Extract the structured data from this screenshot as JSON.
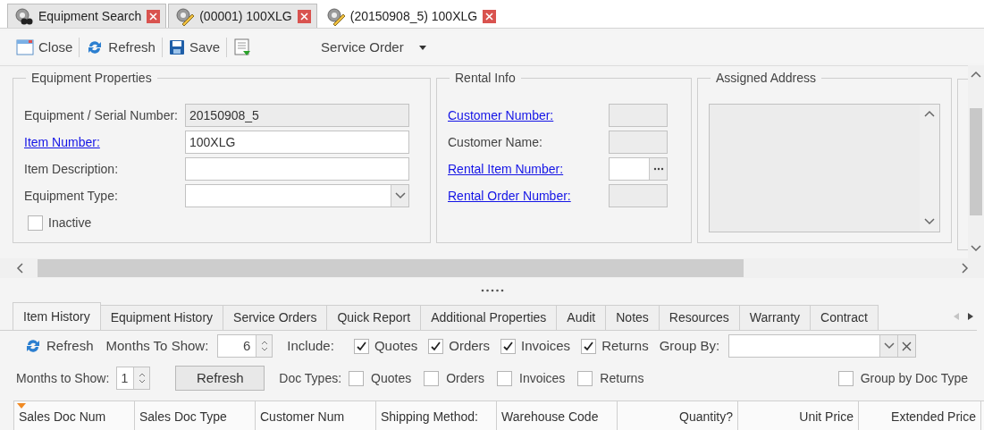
{
  "doc_tabs": [
    {
      "label": "Equipment Search",
      "kind": "search",
      "selected": false
    },
    {
      "label": "(00001) 100XLG",
      "kind": "edit",
      "selected": false
    },
    {
      "label": "(20150908_5) 100XLG",
      "kind": "edit",
      "selected": true
    }
  ],
  "toolbar": [
    {
      "label": "Close",
      "kind": "close"
    },
    {
      "label": "Refresh",
      "kind": "refresh"
    },
    {
      "label": "Save",
      "kind": "save"
    },
    {
      "kind": "report"
    },
    {
      "label": "Service Order",
      "kind": "dropdown"
    }
  ],
  "equipment_properties": {
    "title": "Equipment Properties",
    "fields": [
      {
        "label": "Equipment / Serial Number:",
        "link": false,
        "kind": "text",
        "readonly": true,
        "value": "20150908_5"
      },
      {
        "label": "Item Number:",
        "link": true,
        "kind": "text",
        "readonly": false,
        "value": "100XLG"
      },
      {
        "label": "Item Description:",
        "link": false,
        "kind": "text",
        "readonly": false
      },
      {
        "label": "Equipment Type:",
        "link": false,
        "kind": "combo",
        "readonly": false
      }
    ],
    "inactive": {
      "label": "Inactive",
      "checked": false
    }
  },
  "rental_info": {
    "title": "Rental Info",
    "fields": [
      {
        "label": "Customer Number:",
        "link": true,
        "kind": "text",
        "readonly": true
      },
      {
        "label": "Customer Name:",
        "link": false,
        "kind": "text",
        "readonly": true
      },
      {
        "label": "Rental Item Number:",
        "link": true,
        "kind": "lookup",
        "readonly": false
      },
      {
        "label": "Rental Order Number:",
        "link": true,
        "kind": "text",
        "readonly": true
      }
    ]
  },
  "assigned_address": {
    "title": "Assigned Address"
  },
  "bottom_tabs": [
    {
      "label": "Item History",
      "selected": true
    },
    {
      "label": "Equipment History",
      "selected": false
    },
    {
      "label": "Service Orders",
      "selected": false
    },
    {
      "label": "Quick Report",
      "selected": false
    },
    {
      "label": "Additional Properties",
      "selected": false
    },
    {
      "label": "Audit",
      "selected": false
    },
    {
      "label": "Notes",
      "selected": false
    },
    {
      "label": "Resources",
      "selected": false
    },
    {
      "label": "Warranty",
      "selected": false
    },
    {
      "label": "Contract",
      "selected": false
    }
  ],
  "history_toolbar": {
    "refresh": "Refresh",
    "months_label": "Months To Show:",
    "months_value": "6",
    "include_label": "Include:",
    "includes": [
      {
        "label": "Quotes",
        "checked": true
      },
      {
        "label": "Orders",
        "checked": true
      },
      {
        "label": "Invoices",
        "checked": true
      },
      {
        "label": "Returns",
        "checked": true
      }
    ],
    "group_by_label": "Group By:"
  },
  "filter_row": {
    "months_label": "Months to Show:",
    "months_value": "1",
    "refresh": "Refresh",
    "doc_types_label": "Doc Types:",
    "doc_types": [
      {
        "label": "Quotes",
        "checked": false
      },
      {
        "label": "Orders",
        "checked": false
      },
      {
        "label": "Invoices",
        "checked": false
      },
      {
        "label": "Returns",
        "checked": false
      }
    ],
    "group_by_doc_type": {
      "label": "Group by Doc Type",
      "checked": false
    }
  },
  "grid": {
    "columns": [
      {
        "label": "Sales Doc Num",
        "right_aligned": false,
        "sorted": true
      },
      {
        "label": "Sales Doc Type",
        "right_aligned": false,
        "sorted": false
      },
      {
        "label": "Customer Num",
        "right_aligned": false,
        "sorted": false
      },
      {
        "label": "Shipping Method:",
        "right_aligned": false,
        "sorted": false
      },
      {
        "label": "Warehouse Code",
        "right_aligned": false,
        "sorted": false
      },
      {
        "label": "Quantity?",
        "right_aligned": true,
        "sorted": false
      },
      {
        "label": "Unit Price",
        "right_aligned": true,
        "sorted": false
      },
      {
        "label": "Extended Price",
        "right_aligned": true,
        "sorted": false
      }
    ]
  }
}
